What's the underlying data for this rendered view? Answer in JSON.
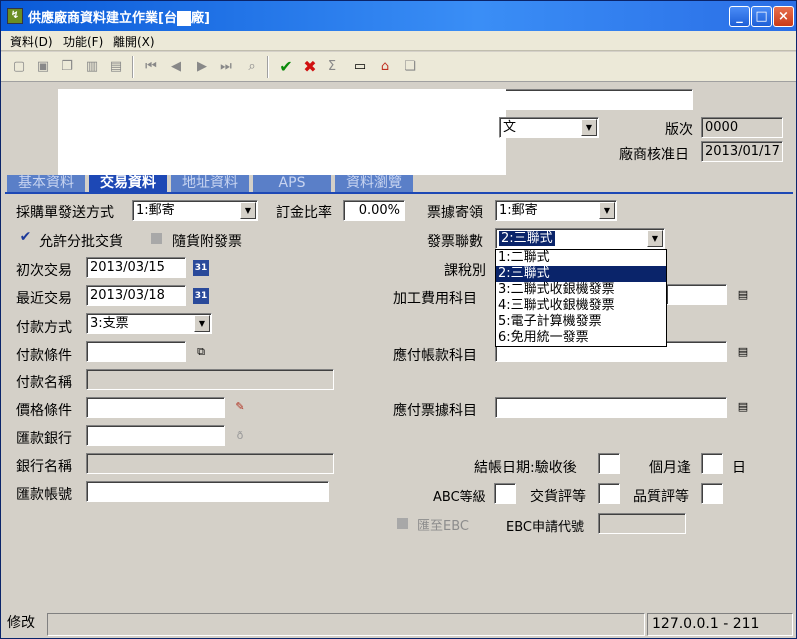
{
  "window": {
    "title": "供應廠商資料建立作業[台",
    "title_suffix": "廠]",
    "minimize": "_",
    "maximize": "□",
    "close": "×"
  },
  "menu": [
    "資料(D)",
    "功能(F)",
    "離開(X)"
  ],
  "toolbar": {
    "confirm": "✔",
    "cancel": "✖"
  },
  "header": {
    "lang_value": "文",
    "version_label": "版次",
    "version_value": "0000",
    "approve_label": "廠商核准日",
    "approve_value": "2013/01/17"
  },
  "tabs": [
    "基本資料",
    "交易資料",
    "地址資料",
    "APS",
    "資料瀏覽"
  ],
  "form": {
    "po_send_label": "採購單發送方式",
    "po_send_value": "1:郵寄",
    "deposit_label": "訂金比率",
    "deposit_value": "0.00%",
    "receipt_label": "票據寄領",
    "receipt_value": "1:郵寄",
    "allow_partial_label": "允許分批交貨",
    "with_invoice_label": "隨貨附發票",
    "invoice_copies_label": "發票聯數",
    "invoice_copies_value": "2:三聯式",
    "first_trade_label": "初次交易",
    "first_trade_value": "2013/03/15",
    "tax_label": "課稅別",
    "last_trade_label": "最近交易",
    "last_trade_value": "2013/03/18",
    "processing_label": "加工費用科目",
    "pay_method_label": "付款方式",
    "pay_method_value": "3:支票",
    "pay_terms_label": "付款條件",
    "ap_account_label": "應付帳款科目",
    "pay_name_label": "付款名稱",
    "price_terms_label": "價格條件",
    "np_account_label": "應付票據科目",
    "remit_bank_label": "匯款銀行",
    "bank_name_label": "銀行名稱",
    "closing_label": "結帳日期:驗收後",
    "month_label": "個月逢",
    "day_label": "日",
    "remit_account_label": "匯款帳號",
    "abc_label": "ABC等級",
    "delivery_rate_label": "交貨評等",
    "quality_rate_label": "品質評等",
    "ebc_label": "匯至EBC",
    "ebc_code_label": "EBC申請代號",
    "calendar_icon": "31"
  },
  "invoice_options": [
    "1:二聯式",
    "2:三聯式",
    "3:二聯式收銀機發票",
    "4:三聯式收銀機發票",
    "5:電子計算機發票",
    "6:免用統一發票"
  ],
  "status": {
    "mode": "修改",
    "server": "127.0.0.1 - 211"
  }
}
